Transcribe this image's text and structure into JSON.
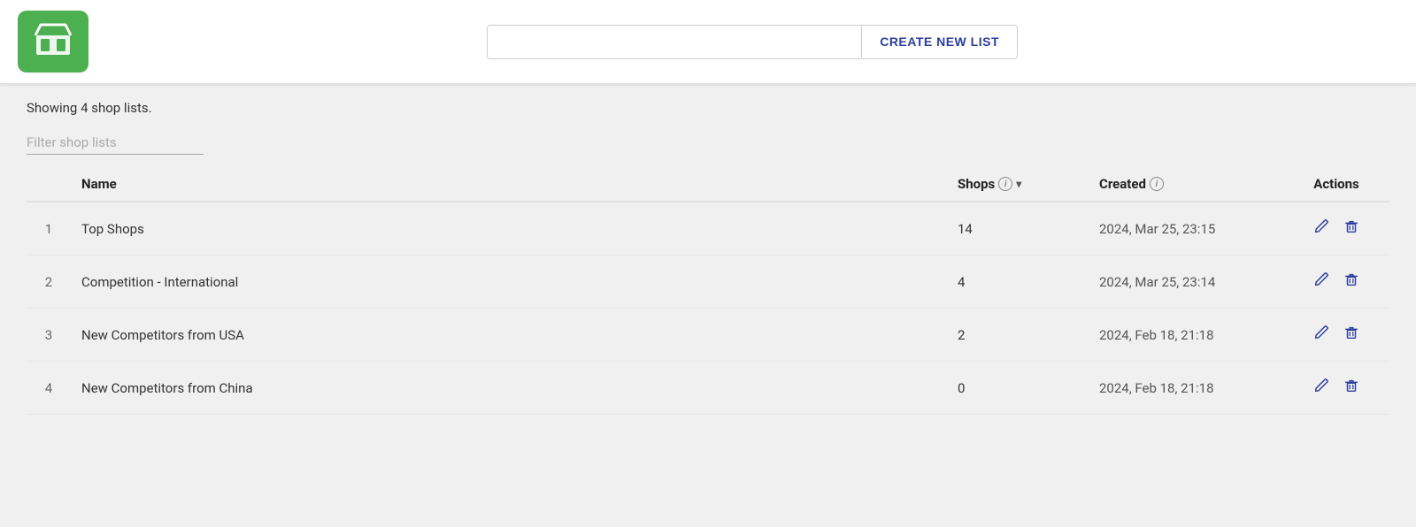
{
  "header": {
    "logo_alt": "Store logo",
    "search_placeholder": "",
    "create_btn_label": "CREATE NEW LIST"
  },
  "main": {
    "showing_text": "Showing 4 shop lists.",
    "filter_placeholder": "Filter shop lists",
    "table": {
      "columns": [
        {
          "key": "num",
          "label": "#"
        },
        {
          "key": "name",
          "label": "Name"
        },
        {
          "key": "shops",
          "label": "Shops"
        },
        {
          "key": "created",
          "label": "Created"
        },
        {
          "key": "actions",
          "label": "Actions"
        }
      ],
      "rows": [
        {
          "num": "1",
          "name": "Top Shops",
          "shops": "14",
          "created": "2024, Mar 25, 23:15"
        },
        {
          "num": "2",
          "name": "Competition - International",
          "shops": "4",
          "created": "2024, Mar 25, 23:14"
        },
        {
          "num": "3",
          "name": "New Competitors from USA",
          "shops": "2",
          "created": "2024, Feb 18, 21:18"
        },
        {
          "num": "4",
          "name": "New Competitors from China",
          "shops": "0",
          "created": "2024, Feb 18, 21:18"
        }
      ]
    }
  },
  "icons": {
    "edit": "✏",
    "delete": "🗑",
    "info": "i",
    "sort_down": "▾"
  }
}
